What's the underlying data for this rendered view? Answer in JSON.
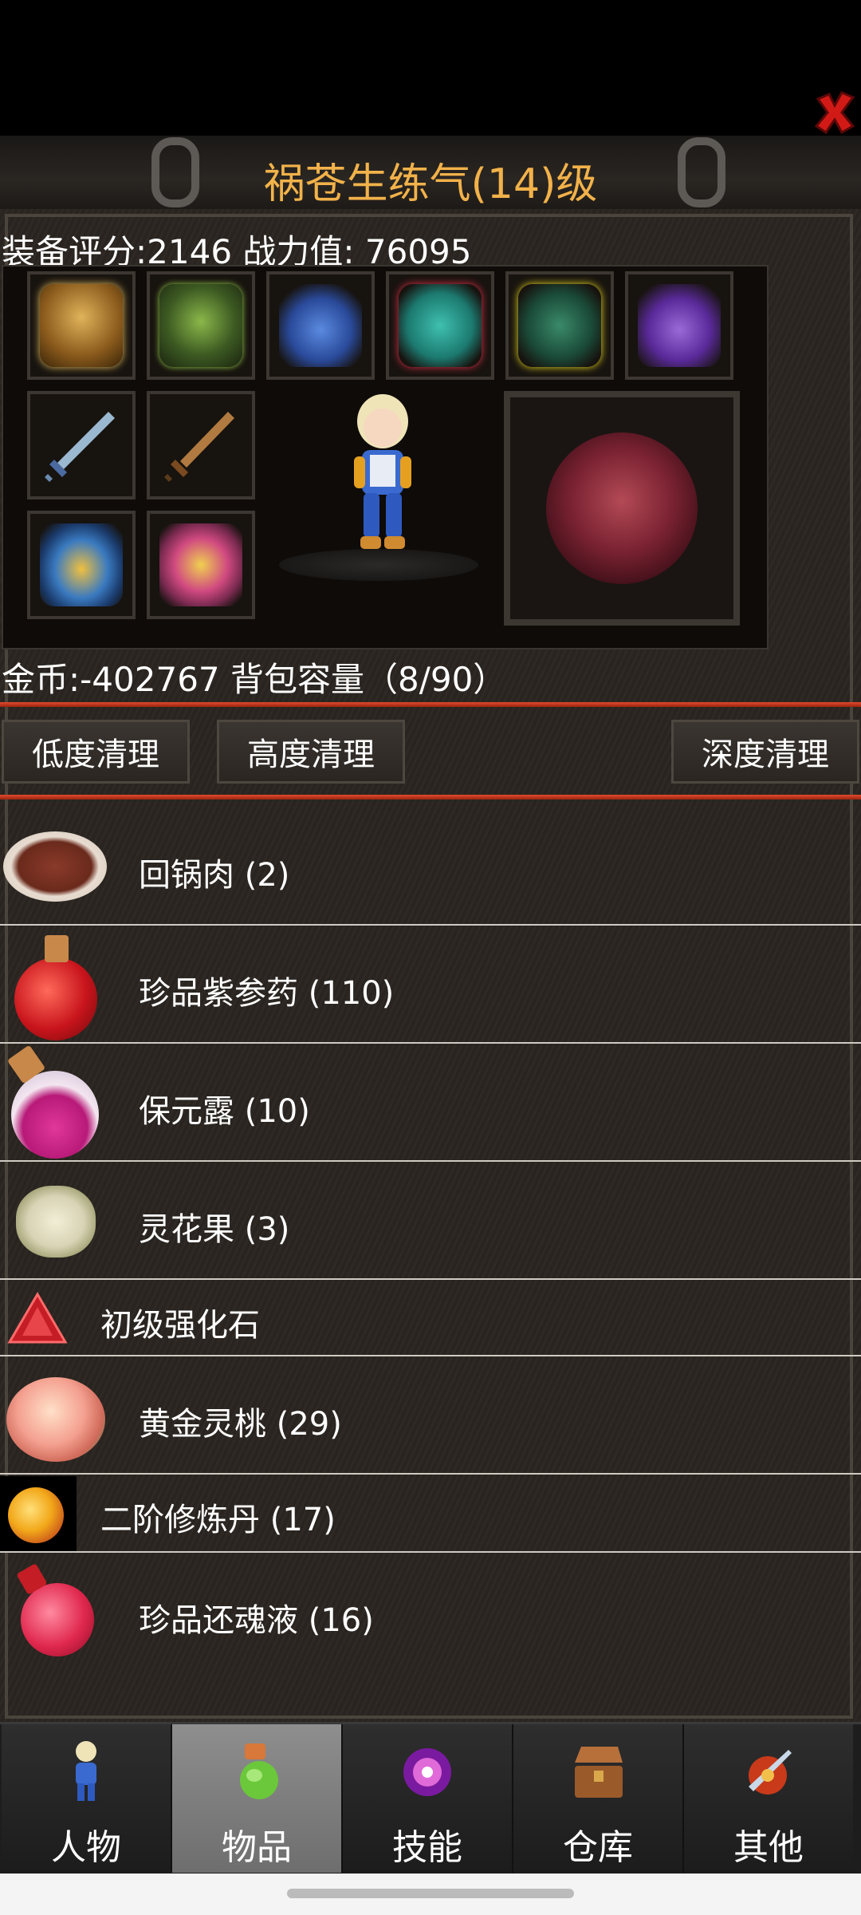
{
  "header": {
    "title": "祸苍生练气(14)级"
  },
  "stats": {
    "line": "装备评分:2146 战力值:  76095"
  },
  "equipment": {
    "slots": [
      "helmet-icon",
      "armor-icon",
      "necklace-icon",
      "bracer-icon",
      "boots-icon",
      "gourd-icon",
      "sword-icon",
      "blade-icon",
      "belt-icon",
      "ring-icon"
    ],
    "mount": "tiger-icon"
  },
  "inventory": {
    "gold_line": "金币:-402767 背包容量（8/90）"
  },
  "actions": {
    "low_clean": "低度清理",
    "high_clean": "高度清理",
    "deep_clean": "深度清理"
  },
  "items": [
    {
      "label": "回锅肉 (2)",
      "icon": "meat-dish-icon",
      "color": "#8a3a2a"
    },
    {
      "label": "珍品紫参药 (110)",
      "icon": "red-potion-icon",
      "color": "#c8141c"
    },
    {
      "label": "保元露 (10)",
      "icon": "pink-potion-icon",
      "color": "#e0379a"
    },
    {
      "label": "灵花果 (3)",
      "icon": "nut-icon",
      "color": "#d8d3b5"
    },
    {
      "label": "初级强化石",
      "icon": "red-gem-icon",
      "color": "#c51d25"
    },
    {
      "label": "黄金灵桃 (29)",
      "icon": "peach-icon",
      "color": "#f4a090"
    },
    {
      "label": "二阶修炼丹 (17)",
      "icon": "orange-pill-icon",
      "color": "#e8901a"
    },
    {
      "label": "珍品还魂液 (16)",
      "icon": "pink-flask-icon",
      "color": "#e0284e"
    }
  ],
  "tabs": [
    {
      "label": "人物",
      "icon": "character-icon"
    },
    {
      "label": "物品",
      "icon": "bag-icon"
    },
    {
      "label": "技能",
      "icon": "skill-icon"
    },
    {
      "label": "仓库",
      "icon": "chest-icon"
    },
    {
      "label": "其他",
      "icon": "misc-icon"
    }
  ],
  "colors": {
    "title": "#f2b24a",
    "divider": "#d8391d",
    "panel": "#2a2520"
  }
}
